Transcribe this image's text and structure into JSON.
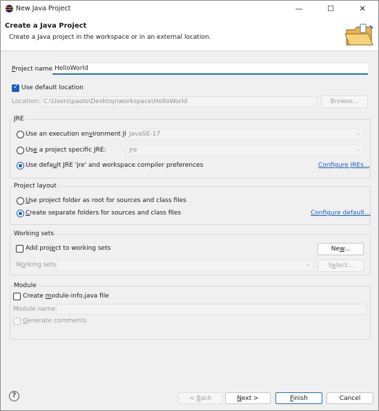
{
  "window": {
    "title": "New Java Project",
    "minimize": "—",
    "maximize": "☐",
    "close": "✕"
  },
  "header": {
    "title": "Create a Java Project",
    "description": "Create a Java project in the workspace or in an external location."
  },
  "project": {
    "name_label": "Project name:",
    "name_value": "HelloWorld",
    "use_default_location": "Use default location",
    "use_default_checked": true,
    "location_label": "Location:",
    "location_value": "C:\\Users\\paolo\\Desktop\\workspace\\HelloWorld",
    "browse_label": "Browse..."
  },
  "jre": {
    "title": "JRE",
    "option_exec_env": "Use an execution environment JRE:",
    "exec_env_value": "JavaSE-17",
    "option_specific": "Use a project specific JRE:",
    "specific_value": "jre",
    "option_default": "Use default JRE 'jre' and workspace compiler preferences",
    "selected": "default",
    "configure_link": "Configure JREs..."
  },
  "layout": {
    "title": "Project layout",
    "option_root": "Use project folder as root for sources and class files",
    "option_separate": "Create separate folders for sources and class files",
    "selected": "separate",
    "configure_link": "Configure default..."
  },
  "working_sets": {
    "title": "Working sets",
    "add_label": "Add project to working sets",
    "add_checked": false,
    "new_label": "New...",
    "sets_label": "Working sets:",
    "select_label": "Select..."
  },
  "module": {
    "title": "Module",
    "create_label": "Create module-info.java file",
    "create_checked": false,
    "name_label": "Module name:",
    "generate_comments": "Generate comments"
  },
  "footer": {
    "help": "?",
    "back": "< Back",
    "next": "Next >",
    "finish": "Finish",
    "cancel": "Cancel"
  }
}
